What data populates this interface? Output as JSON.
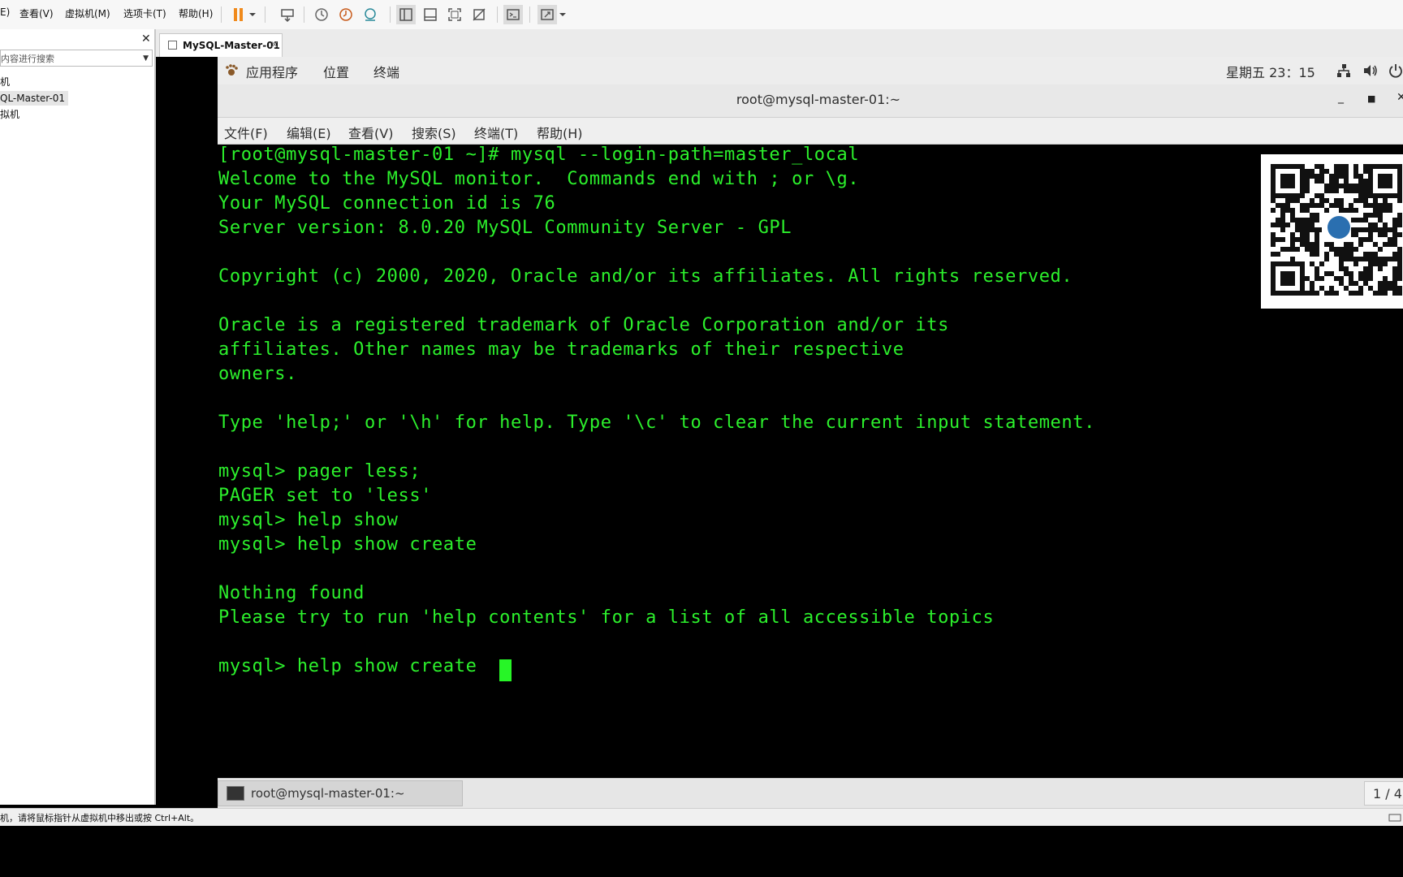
{
  "vmware": {
    "menu": [
      "E)",
      "查看(V)",
      "虚拟机(M)",
      "选项卡(T)",
      "帮助(H)"
    ],
    "sidebar": {
      "search_placeholder": "内容进行搜索",
      "items": [
        "机",
        "QL-Master-01",
        "拟机"
      ]
    },
    "tab_label": "MySQL-Master-01",
    "status_text": "机，请将鼠标指针从虚拟机中移出或按 Ctrl+Alt。"
  },
  "gnome": {
    "apps": "应用程序",
    "places": "位置",
    "terminal": "终端",
    "clock": "星期五 23：15",
    "taskbar_item": "root@mysql-master-01:~",
    "workspace": "1 / 4"
  },
  "terminal": {
    "title": "root@mysql-master-01:~",
    "menu": [
      "文件(F)",
      "编辑(E)",
      "查看(V)",
      "搜索(S)",
      "终端(T)",
      "帮助(H)"
    ],
    "lines": [
      "[root@mysql-master-01 ~]# mysql --login-path=master_local",
      "Welcome to the MySQL monitor.  Commands end with ; or \\g.",
      "Your MySQL connection id is 76",
      "Server version: 8.0.20 MySQL Community Server - GPL",
      "",
      "Copyright (c) 2000, 2020, Oracle and/or its affiliates. All rights reserved.",
      "",
      "Oracle is a registered trademark of Oracle Corporation and/or its",
      "affiliates. Other names may be trademarks of their respective",
      "owners.",
      "",
      "Type 'help;' or '\\h' for help. Type '\\c' to clear the current input statement.",
      "",
      "mysql> pager less;",
      "PAGER set to 'less'",
      "mysql> help show",
      "mysql> help show create",
      "",
      "Nothing found",
      "Please try to run 'help contents' for a list of all accessible topics",
      "",
      "mysql> help show create"
    ]
  },
  "colors": {
    "terminal_fg": "#2cf02c",
    "terminal_bg": "#000000",
    "cursor": "#27f527",
    "pause_orange": "#f08a1c"
  }
}
